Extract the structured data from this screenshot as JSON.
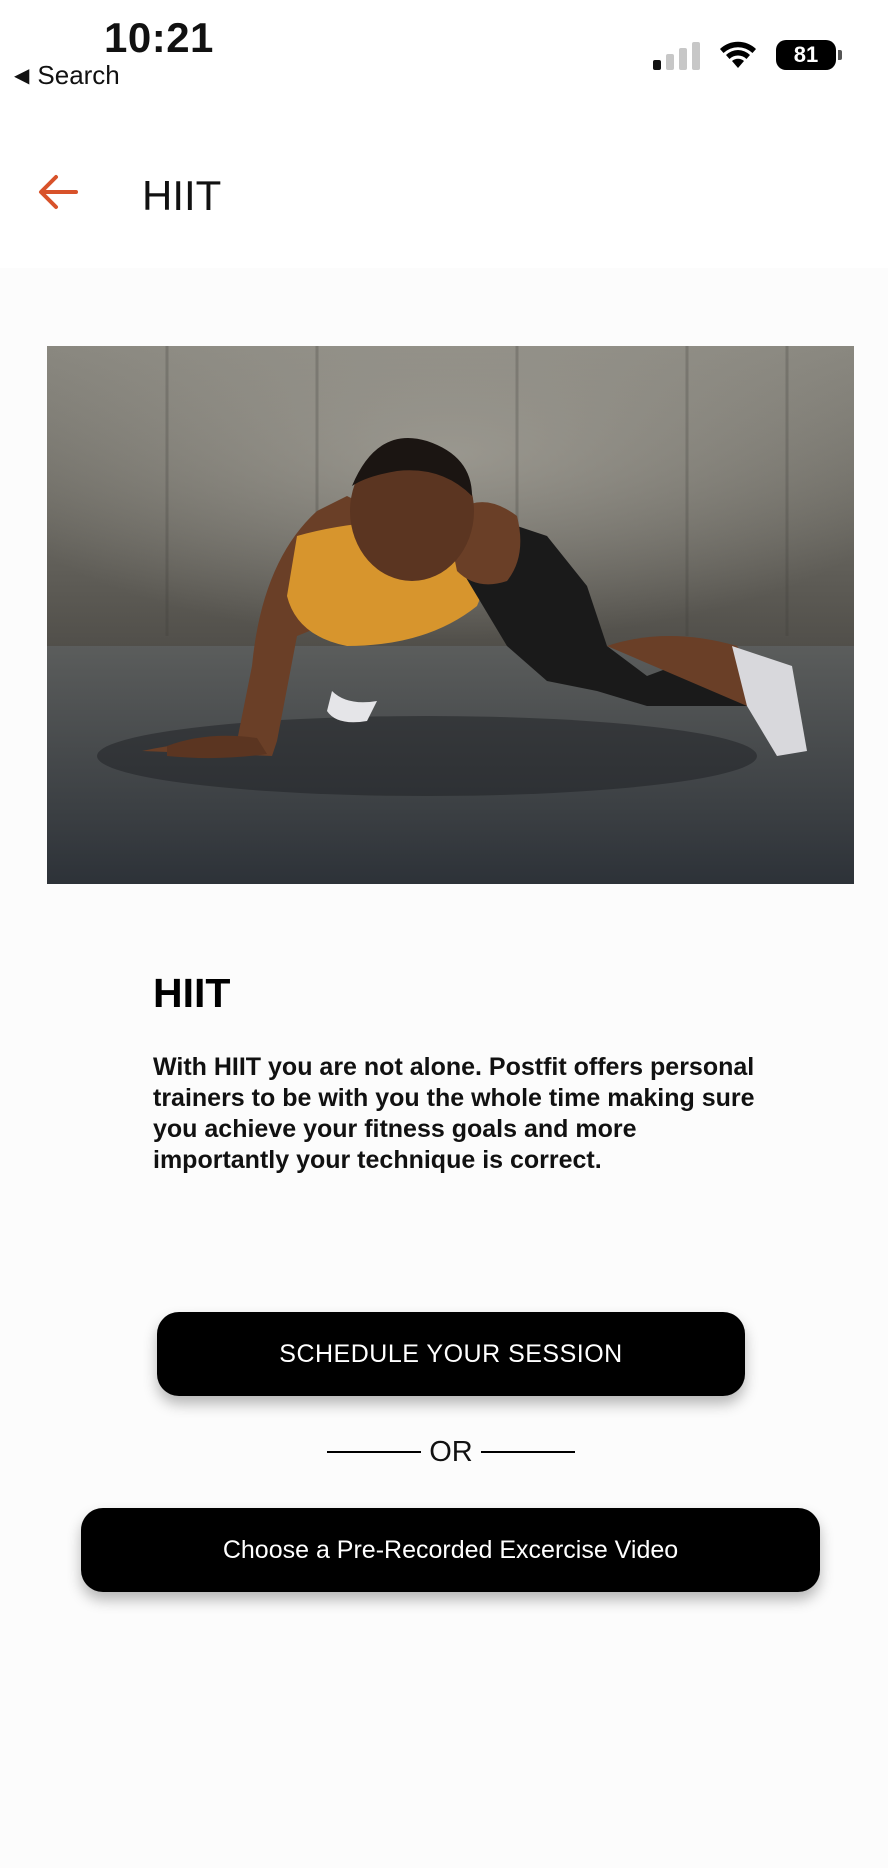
{
  "status_bar": {
    "time": "10:21",
    "back_app": "Search",
    "battery": "81"
  },
  "header": {
    "title": "HIIT"
  },
  "content": {
    "title": "HIIT",
    "description": "With HIIT you are not alone. Postfit offers personal trainers to be with you the whole time making sure you achieve your fitness goals and more importantly your technique is correct."
  },
  "actions": {
    "schedule_label": "SCHEDULE YOUR SESSION",
    "or_label": "OR",
    "video_label": "Choose a Pre-Recorded Excercise Video"
  },
  "colors": {
    "accent": "#d8522a",
    "button_bg": "#000000",
    "button_text": "#ffffff",
    "page_bg": "#fcfcfc"
  },
  "icons": {
    "back": "arrow-left-icon",
    "status_back": "back-triangle-icon",
    "signal": "cellular-signal-icon",
    "wifi": "wifi-icon",
    "battery": "battery-icon"
  }
}
